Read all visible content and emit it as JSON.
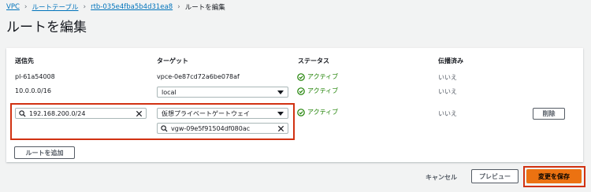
{
  "breadcrumb": {
    "items": [
      "VPC",
      "ルートテーブル",
      "rtb-035e4fba5b4d31ea8"
    ],
    "current": "ルートを編集"
  },
  "page_title": "ルートを編集",
  "columns": {
    "destination": "送信先",
    "target": "ターゲット",
    "status": "ステータス",
    "propagated": "伝播済み"
  },
  "rows": [
    {
      "destination": "pl-61a54008",
      "target": "vpce-0e87cd72a6be078af",
      "status": "アクティブ",
      "propagated": "いいえ"
    },
    {
      "destination": "10.0.0.0/16",
      "target_select": "local",
      "status": "アクティブ",
      "propagated": "いいえ"
    },
    {
      "destination_input": "192.168.200.0/24",
      "target_select": "仮想プライベートゲートウェイ",
      "target_search": "vgw-09e5f91504df080ac",
      "status": "アクティブ",
      "propagated": "いいえ",
      "remove_label": "削除"
    }
  ],
  "add_route_label": "ルートを追加",
  "footer": {
    "cancel_label": "キャンセル",
    "preview_label": "プレビュー",
    "save_label": "変更を保存"
  },
  "colors": {
    "link": "#0073bb",
    "success": "#1d8102",
    "primary": "#ec7211",
    "highlight": "#d13212"
  }
}
